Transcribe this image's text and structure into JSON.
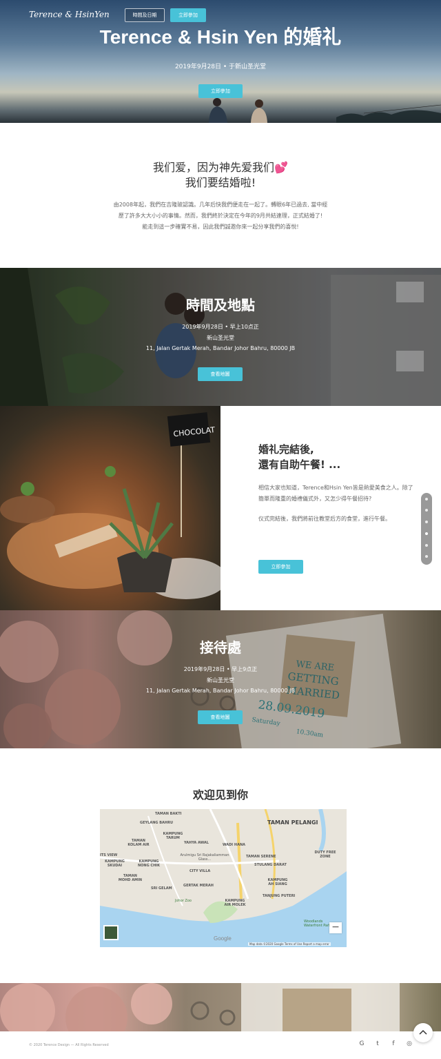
{
  "hero": {
    "brand": "Terence & HsinYen",
    "nav": {
      "schedule": "時間及日期",
      "join": "立即參加"
    },
    "title": "Terence & Hsin Yen 的婚礼",
    "subtitle": "2019年9月28日 • 于新山圣光堂",
    "cta": "立即參加"
  },
  "intro": {
    "heading_line1": "我们爱，因为神先爱我们💕",
    "heading_line2": "我们要结婚啦!",
    "line1": "由2008年起，我們在吉隆玻認識。几年后快我們便走在一起了。轉眼6年已過去, 當中經",
    "line2": "歷了許多大大小小的事情。然而，我們終於決定在今年的9月共結連理，正式結婚了!",
    "line3": "能走到這一步確實不易，因此我們誠邀你來一起分享我們的喜悅!"
  },
  "time_place": {
    "heading": "時間及地點",
    "date": "2019年9月28日 • 早上10点正",
    "venue": "新山圣光堂",
    "address": "11, Jalan Gertak Merah, Bandar Johor Bahru, 80000 JB",
    "button": "查看地圖"
  },
  "buffet": {
    "heading_line1": "婚礼完結後,",
    "heading_line2": "還有自助午餐! ...",
    "para1": "相信大家也知道，Terence和Hsin Yen皆是熱愛美食之人。除了簡單而隆重的婚禮儀式外，又怎少得午餐招待?",
    "para2": "仪式完結後，我們將前往教堂后方的食堂，進行午餐。",
    "button": "立即參加",
    "sign_text": "CHOCOLAT"
  },
  "reception": {
    "heading": "接待處",
    "date": "2019年9月28日 • 早上9点正",
    "venue": "新山圣光堂",
    "address": "11, Jalan Gertak Merah, Bandar Johor Bahru, 80000 JB",
    "button": "查看地圖",
    "card_line1": "WE ARE",
    "card_line2": "GETTING",
    "card_line3": "MARRIED",
    "card_date": "28.09.2019",
    "card_day": "Saturday",
    "card_time": "10.30am"
  },
  "map": {
    "heading": "欢迎见到你",
    "labels": {
      "taman_bakti": "TAMAN BAKTI",
      "geylang_bahru": "GEYLANG BAHRU",
      "taman_pelangi": "TAMAN PELANGI",
      "taman_kolam_air": "TAMAN KOLAM AIR",
      "kampung_tarum": "KAMPUNG TARUM",
      "yahya_awal": "YAHYA AWAL",
      "wadi_hana": "WADI HANA",
      "taman_serene": "TAMAN SERENE",
      "duty_free_zone": "DUTY FREE ZONE",
      "its_view": "ITS VIEW",
      "kampung_skudai": "KAMPUNG SKUDAI",
      "kampung_nong_chik": "KAMPUNG NONG CHIK",
      "arulmigu": "Arulmigu Sri Rajakaliamman Glass...",
      "stulang_darat": "STULANG DARAT",
      "city_villa": "CITY VILLA",
      "taman_mohd_amin": "TAMAN MOHD AMIN",
      "sri_gelam": "SRI GELAM",
      "gertak_merah": "GERTAK MERAH",
      "kampung_ah_siang": "KAMPUNG AH SIANG",
      "tanjung_puteri": "TANJUNG PUTERI",
      "johor_zoo": "Johor Zoo",
      "kampung_air_molek": "KAMPUNG AIR MOLEK",
      "woodlands": "Woodlands Waterfront Park"
    },
    "google": "Google",
    "attribution": "Map data ©2020 Google   Terms of Use   Report a map error",
    "zoom_out": "−"
  },
  "footer": {
    "copyright": "© 2020 Terence Design — All Rights Reserved",
    "social": {
      "google": "G",
      "twitter": "t",
      "facebook": "f",
      "instagram": "◎"
    },
    "to_top": "^"
  },
  "colors": {
    "accent": "#48c2d8"
  }
}
